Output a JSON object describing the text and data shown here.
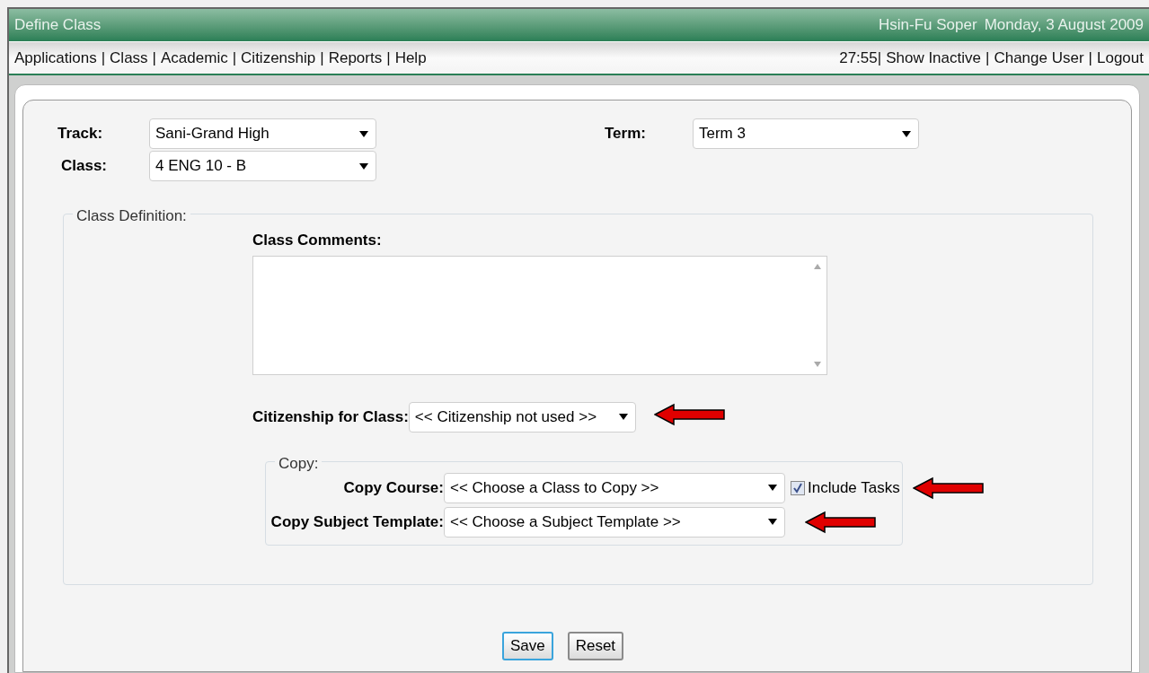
{
  "title_bar": {
    "title": "Define Class",
    "user": "Hsin-Fu Soper",
    "date": "Monday, 3 August 2009"
  },
  "menu": {
    "separator": "|",
    "items": [
      "Applications",
      "Class",
      "Academic",
      "Citizenship",
      "Reports",
      "Help"
    ],
    "timer": "27:55",
    "right_items": [
      "Show Inactive",
      "Change User",
      "Logout"
    ]
  },
  "track": {
    "label": "Track:",
    "value": "Sani-Grand High"
  },
  "class": {
    "label": "Class:",
    "value": "4 ENG 10 - B"
  },
  "term": {
    "label": "Term:",
    "value": "Term 3"
  },
  "class_definition": {
    "legend": "Class Definition:",
    "comments_label": "Class Comments:",
    "citizenship": {
      "label": "Citizenship for Class:",
      "value": "<< Citizenship not used >>"
    },
    "copy": {
      "legend": "Copy:",
      "course": {
        "label": "Copy Course:",
        "value": "<< Choose a Class to Copy >>"
      },
      "include_tasks": {
        "label": "Include Tasks",
        "checked": true
      },
      "template": {
        "label": "Copy Subject Template:",
        "value": "<< Choose a Subject Template >>"
      }
    }
  },
  "buttons": [
    {
      "label": "Save",
      "focused": true
    },
    {
      "label": "Reset",
      "focused": false
    }
  ]
}
